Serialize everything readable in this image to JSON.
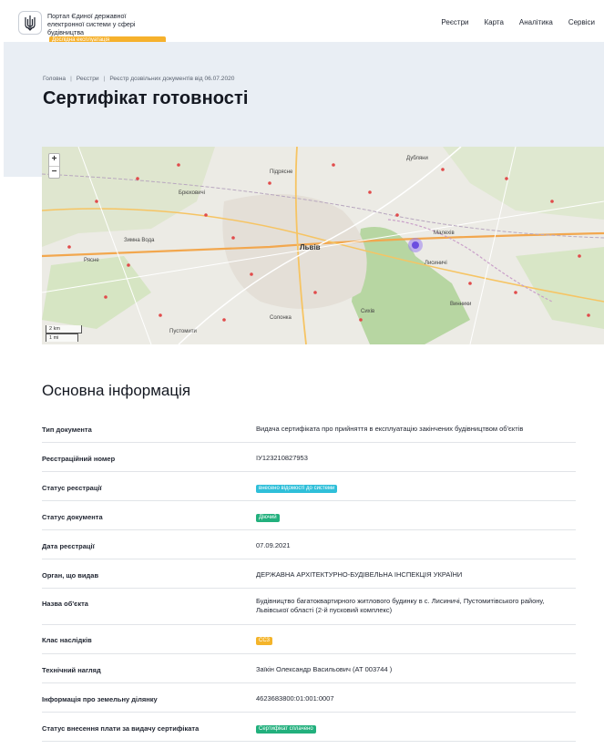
{
  "header": {
    "brand_lines": [
      "Портал Єдиної державної",
      "електронної системи у сфері",
      "будівництва"
    ],
    "badge": "Дослідна експлуатація",
    "nav": [
      "Реєстри",
      "Карта",
      "Аналітика",
      "Сервіси"
    ]
  },
  "breadcrumb": [
    "Головна",
    "Реєстри",
    "Реєстр дозвільних документів від 06.07.2020"
  ],
  "page_title": "Сертифікат готовності",
  "map": {
    "zoom_in": "+",
    "zoom_out": "−",
    "scale": [
      "2 km",
      "1 mi"
    ],
    "labels": [
      "Рясне",
      "Львів",
      "Сихів",
      "Винники",
      "Пустомити",
      "Малехів",
      "Зимна Вода",
      "Дубляни",
      "Лисиничі",
      "Брюховичі",
      "Підрясне",
      "Солонка"
    ]
  },
  "section_title": "Основна інформація",
  "rows": [
    {
      "label": "Тип документа",
      "value": "Видача сертифіката про прийняття в експлуатацію закінчених будівництвом об'єктів"
    },
    {
      "label": "Реєстраційний номер",
      "value": "ІУ123210827953"
    },
    {
      "label": "Статус реєстрації",
      "tag": "внесено відомості до системи",
      "tag_color": "#2fbfd9"
    },
    {
      "label": "Статус документа",
      "tag": "Діючий",
      "tag_color": "#22b07d"
    },
    {
      "label": "Дата реєстрації",
      "value": "07.09.2021"
    },
    {
      "label": "Орган, що видав",
      "value": "ДЕРЖАВНА АРХІТЕКТУРНО-БУДІВЕЛЬНА ІНСПЕКЦІЯ УКРАЇНИ"
    },
    {
      "label": "Назва об'єкта",
      "value": "Будівництво багатоквартирного житлового будинку в с. Лисиничі, Пустомитівського району, Львівської області (2-й пусковий комплекс)"
    },
    {
      "label": "Клас наслідків",
      "tag": "СС3",
      "tag_color": "#f4b42a"
    },
    {
      "label": "Технічний нагляд",
      "value": "Заїкін Олександр Васильович (АТ 003744 )"
    },
    {
      "label": "Інформація про земельну ділянку",
      "value": "4623683800:01:001:0007"
    },
    {
      "label": "Статус внесення плати за видачу сертифіката",
      "tag": "Сертифікат сплачено",
      "tag_color": "#22b07d"
    }
  ]
}
